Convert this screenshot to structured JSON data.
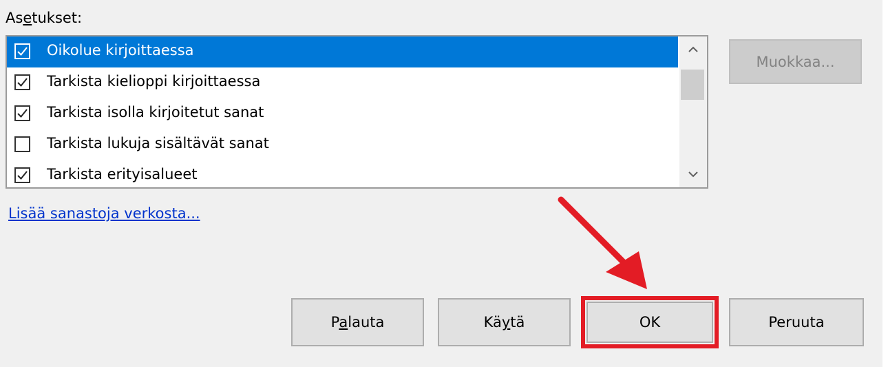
{
  "settings": {
    "label_before": "As",
    "label_underline": "e",
    "label_after": "tukset:",
    "items": [
      {
        "label": "Oikolue kirjoittaessa",
        "checked": true,
        "selected": true
      },
      {
        "label": "Tarkista kielioppi kirjoittaessa",
        "checked": true,
        "selected": false
      },
      {
        "label": "Tarkista isolla kirjoitetut sanat",
        "checked": true,
        "selected": false
      },
      {
        "label": "Tarkista lukuja sisältävät sanat",
        "checked": false,
        "selected": false
      },
      {
        "label": "Tarkista erityisalueet",
        "checked": true,
        "selected": false
      }
    ]
  },
  "edit_button": {
    "label": "Muokkaa...",
    "enabled": false
  },
  "link": {
    "label": "Lisää sanastoja verkosta..."
  },
  "buttons": {
    "reset": {
      "before": "P",
      "underline": "a",
      "after": "lauta"
    },
    "apply": {
      "before": "Kä",
      "underline": "y",
      "after": "tä"
    },
    "ok": {
      "label": "OK"
    },
    "cancel": {
      "label": "Peruuta"
    }
  },
  "annotation": {
    "color": "#e31c25"
  },
  "colors": {
    "selection": "#0078d7",
    "link": "#0033cc"
  }
}
